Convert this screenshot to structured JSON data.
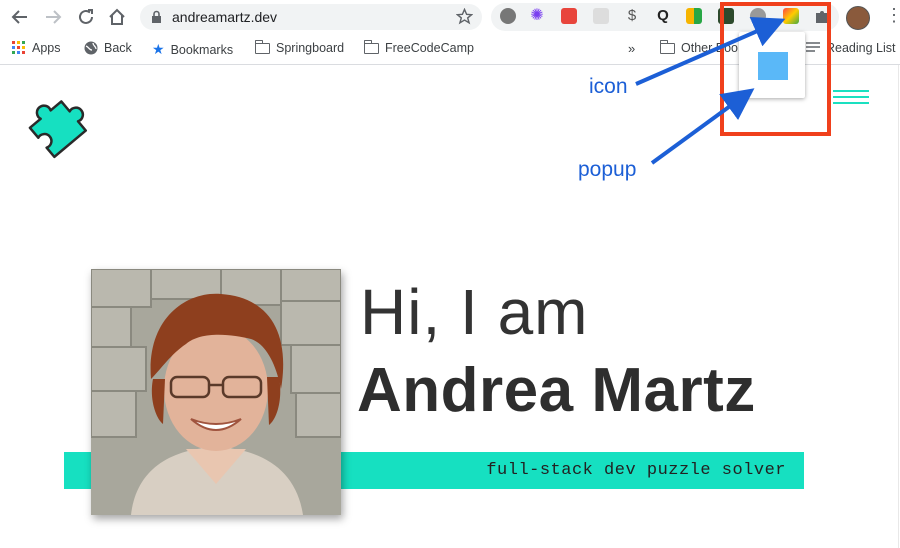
{
  "browser": {
    "url": "andreamartz.dev",
    "bookmarks": [
      {
        "label": "Apps",
        "icon": "apps-grid-icon"
      },
      {
        "label": "Back",
        "icon": "globe-icon"
      },
      {
        "label": "Bookmarks",
        "icon": "star-icon"
      },
      {
        "label": "Springboard",
        "icon": "folder-icon"
      },
      {
        "label": "FreeCodeCamp",
        "icon": "folder-icon"
      },
      {
        "label": "Other Boo",
        "icon": "folder-icon"
      },
      {
        "label": "Reading List",
        "icon": "reading-list-icon"
      }
    ],
    "overflow_label": "»"
  },
  "page": {
    "greeting": "Hi, I am",
    "name": "Andrea Martz",
    "tagline": "full-stack dev puzzle solver",
    "accent_color": "#16e0c1"
  },
  "annotations": {
    "icon_label": "icon",
    "popup_label": "popup",
    "arrow_color": "#1c5fd6",
    "highlight_color": "#f0401c"
  }
}
